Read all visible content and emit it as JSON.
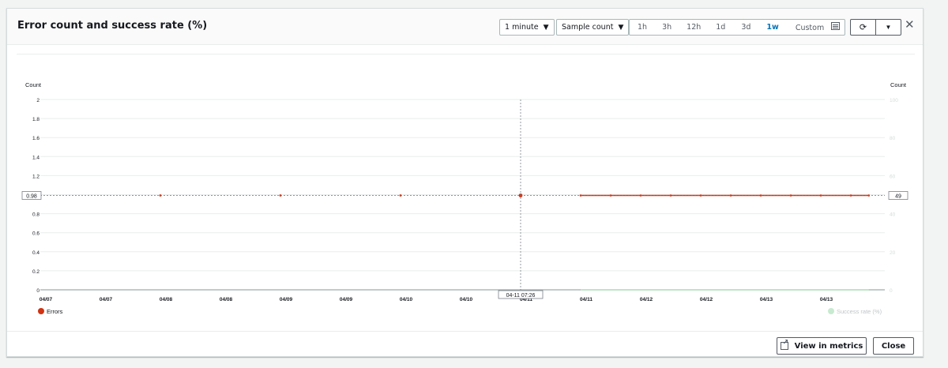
{
  "widget": {
    "title": "Error count and success rate (%)",
    "period": "1 minute",
    "statistic": "Sample count",
    "ranges": [
      "1h",
      "3h",
      "12h",
      "1d",
      "3d",
      "1w"
    ],
    "active_range": "1w",
    "custom_label": "Custom",
    "refresh_icon": "refresh-icon",
    "dropdown_icon": "caret-down-icon",
    "close_icon": "close-icon"
  },
  "footer": {
    "view_in_metrics": "View in metrics",
    "close": "Close"
  },
  "colors": {
    "errors": "#d13212",
    "success": "#98d6a0",
    "active_range": "#0073bb"
  },
  "chart_data": {
    "type": "line",
    "left_axis_label": "Count",
    "right_axis_label": "Count",
    "left_ylim": [
      0,
      2
    ],
    "left_ticks": [
      "0",
      "0.2",
      "0.4",
      "0.6",
      "0.8",
      "1",
      "1.2",
      "1.4",
      "1.6",
      "1.8",
      "2"
    ],
    "right_ylim": [
      0,
      100
    ],
    "right_ticks": [
      "0",
      "20",
      "40",
      "60",
      "80",
      "100"
    ],
    "x_ticks": [
      "04/07",
      "04/07",
      "04/08",
      "04/08",
      "04/09",
      "04/09",
      "04/10",
      "04/10",
      "04/11",
      "04/11",
      "04/12",
      "04/12",
      "04/13",
      "04/13"
    ],
    "crosshair": {
      "x_label": "04-11 07:26",
      "left_value": "0.98",
      "right_value": "49"
    },
    "series": [
      {
        "name": "Errors",
        "axis": "left",
        "isolated_points": [
          {
            "day": 1.0,
            "y": 1.0
          },
          {
            "day": 2.0,
            "y": 1.0
          },
          {
            "day": 3.0,
            "y": 1.0
          },
          {
            "day": 4.0,
            "y": 1.0
          }
        ],
        "line": {
          "day_start": 4.5,
          "day_end": 6.9,
          "y": 1.0
        },
        "line_markers": [
          4.5,
          4.75,
          5.0,
          5.25,
          5.5,
          5.75,
          6.0,
          6.25,
          6.5,
          6.75,
          6.9
        ]
      },
      {
        "name": "Success rate (%)",
        "axis": "right",
        "line": {
          "day_start": 4.5,
          "day_end": 6.9,
          "y": 0
        }
      }
    ],
    "legend": [
      "Errors",
      "Success rate (%)"
    ],
    "grid": true
  }
}
